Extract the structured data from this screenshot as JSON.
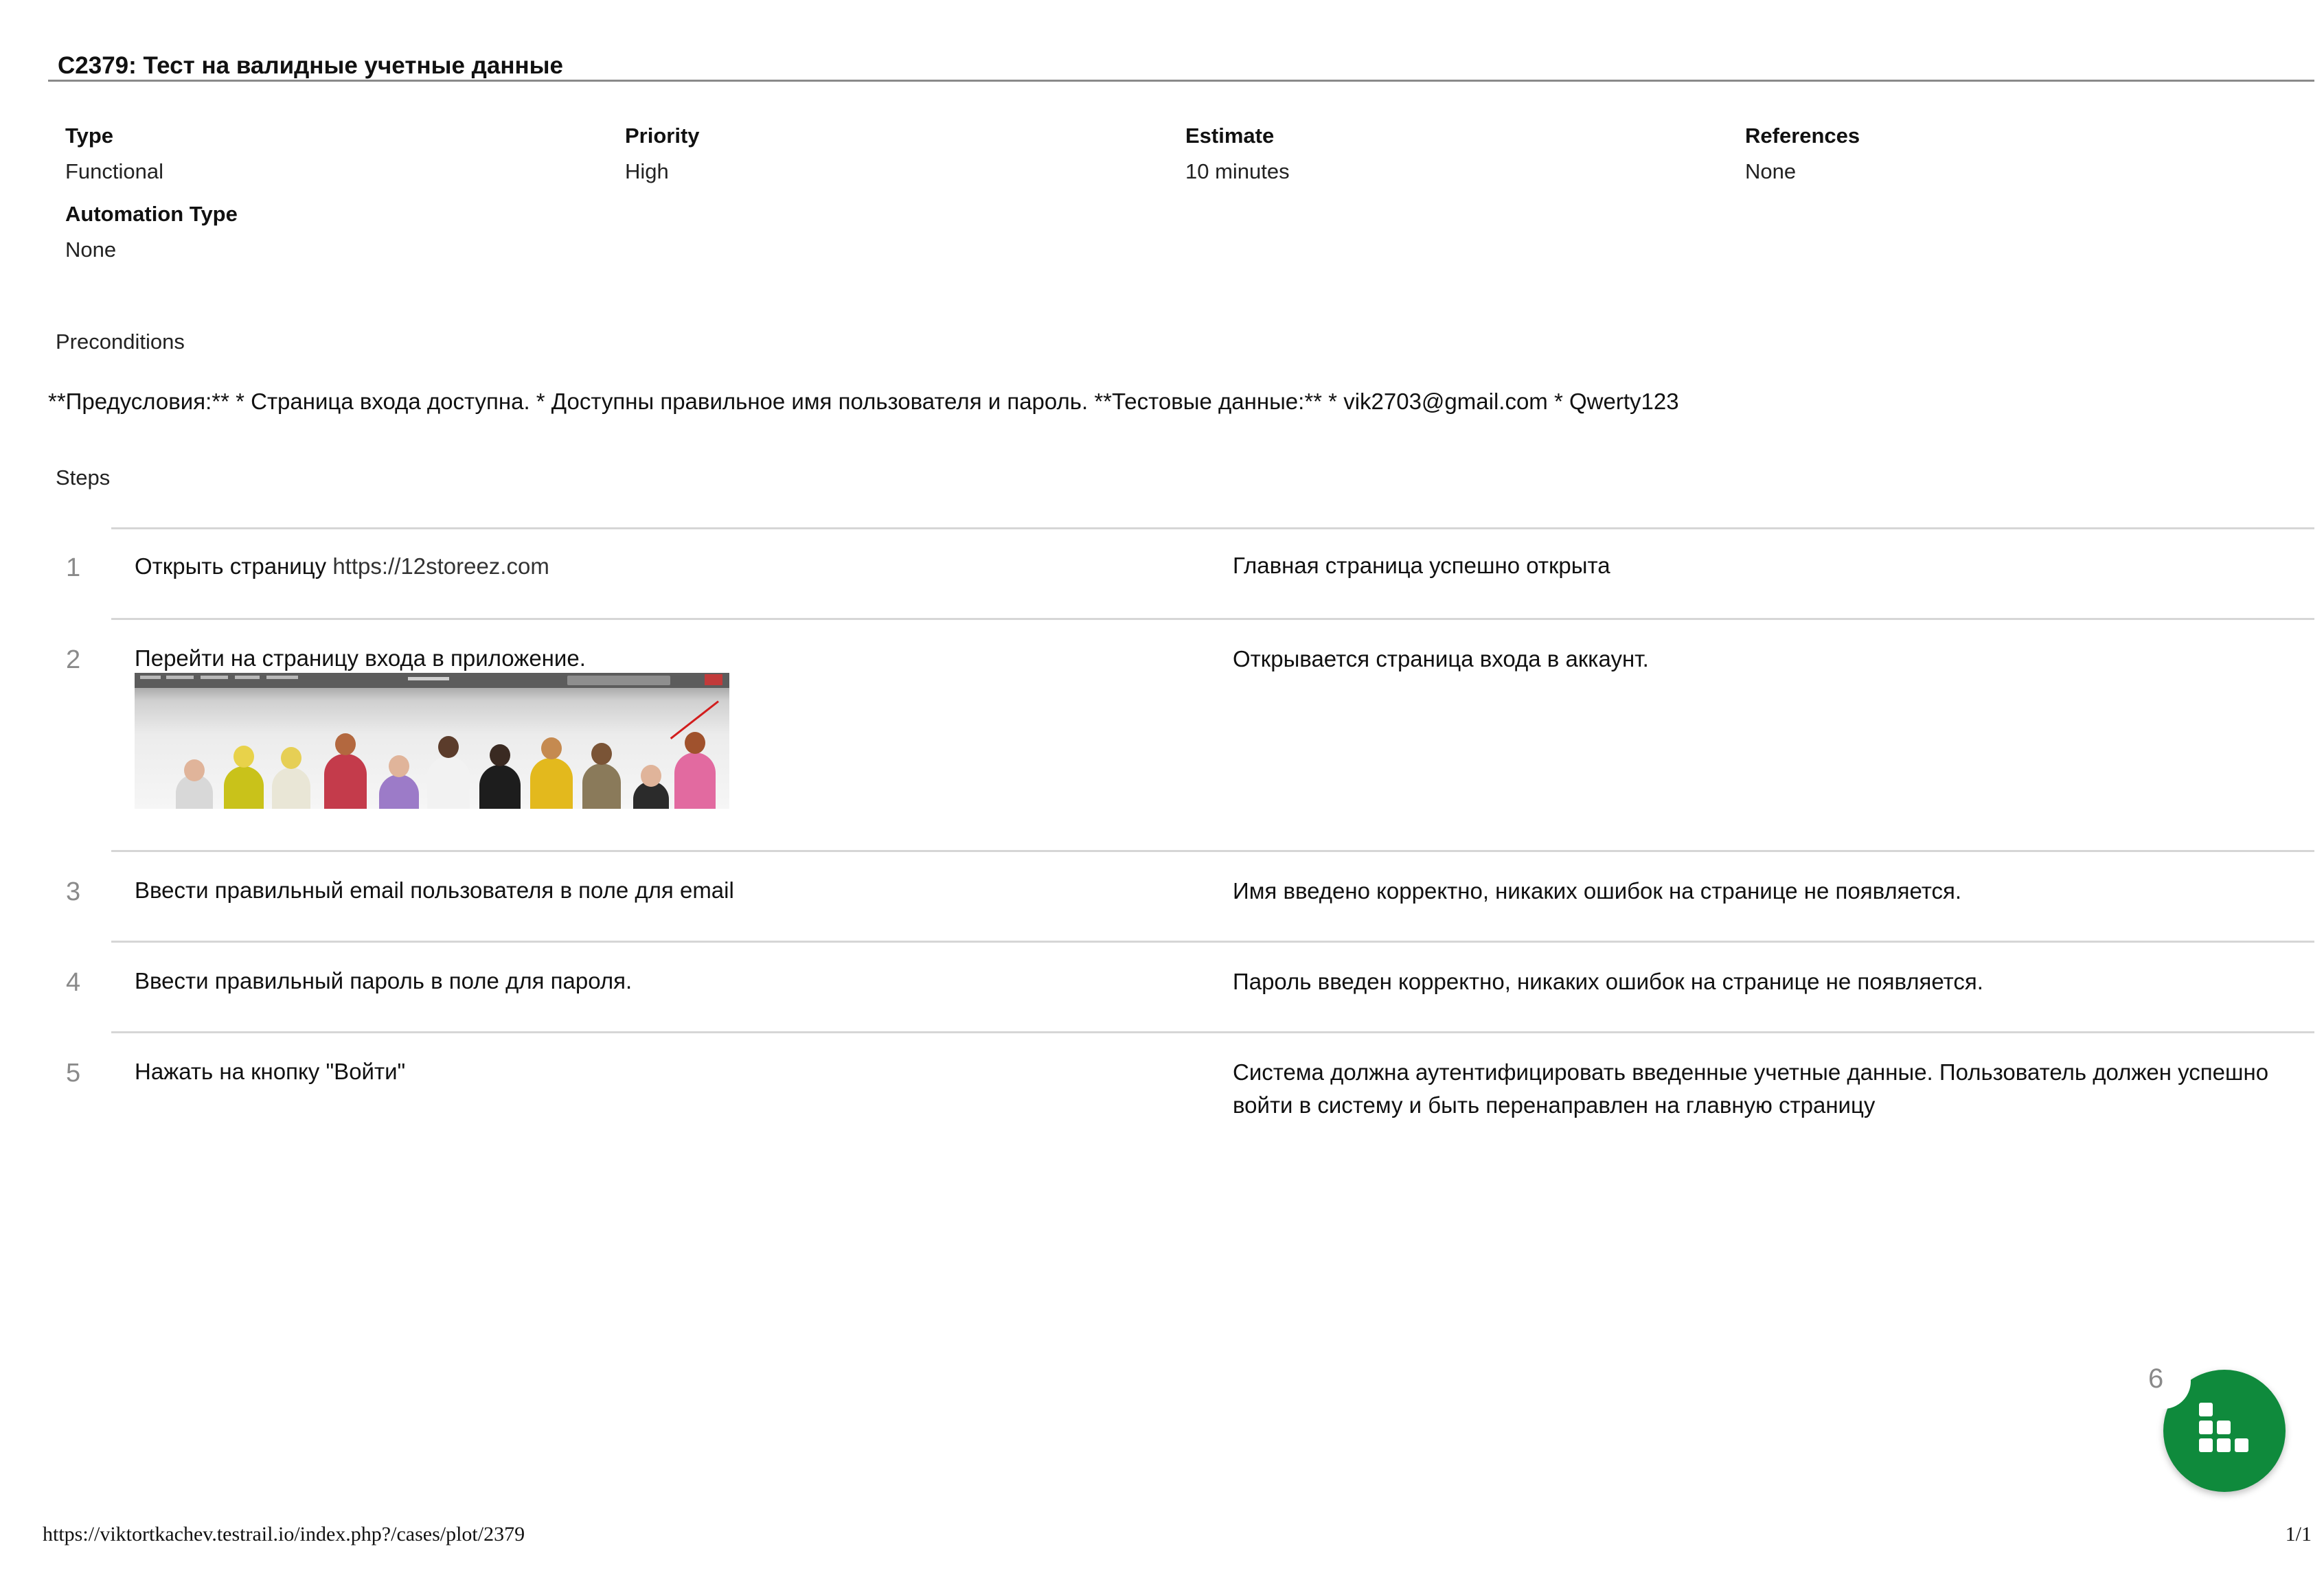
{
  "document": {
    "title": "C2379: Тест на валидные учетные данные"
  },
  "fields": [
    {
      "label": "Type",
      "value": "Functional"
    },
    {
      "label": "Priority",
      "value": "High"
    },
    {
      "label": "Estimate",
      "value": "10 minutes"
    },
    {
      "label": "References",
      "value": "None"
    },
    {
      "label": "Automation Type",
      "value": "None"
    }
  ],
  "preconditions": {
    "label": "Preconditions",
    "text": "**Предусловия:** * Страница входа доступна. * Доступны правильное имя пользователя и пароль. **Тестовые данные:** * vik2703@gmail.com * Qwerty123"
  },
  "steps": {
    "label": "Steps",
    "items": [
      {
        "number": "1",
        "action": "Открыть страницу ",
        "action_link": "https://12storeez.com",
        "expected": "Главная страница успешно открыта"
      },
      {
        "number": "2",
        "action": "Перейти на страницу входа в приложение.",
        "expected": "Открывается страница входа в аккаунт."
      },
      {
        "number": "3",
        "action": "Ввести правильный email пользователя в поле для email",
        "expected": "Имя введено корректно, никаких ошибок на странице не появляется."
      },
      {
        "number": "4",
        "action": "Ввести правильный пароль в поле для пароля.",
        "expected": "Пароль введен корректно, никаких ошибок на странице не появляется."
      },
      {
        "number": "5",
        "action": "Нажать на кнопку \"Войти\"",
        "expected": "Система должна аутентифицировать введенные учетные данные. Пользователь должен успешно войти в систему и быть перенаправлен на главную страницу"
      }
    ],
    "attachment_icon": "screenshot-image"
  },
  "footer": {
    "url": "https://viktortkachev.testrail.io/index.php?/cases/plot/2379",
    "page": "1/1"
  },
  "widget": {
    "badge_count": "6",
    "icon": "grid-dots-icon",
    "color": "#0f8a3c"
  }
}
